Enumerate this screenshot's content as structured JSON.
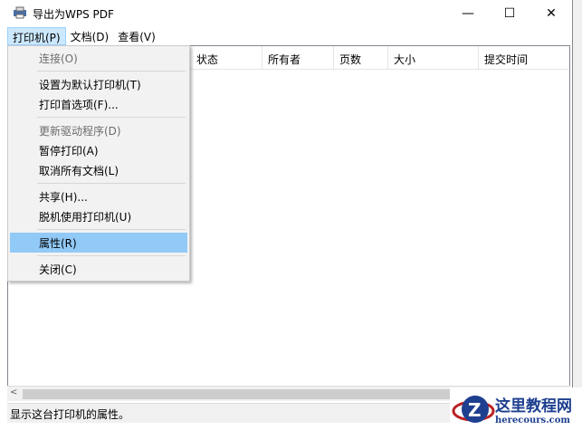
{
  "window": {
    "title": "导出为WPS PDF",
    "minimize": "—",
    "maximize": "☐",
    "close": "✕"
  },
  "menubar": [
    {
      "label": "打印机(P)"
    },
    {
      "label": "文档(D)"
    },
    {
      "label": "查看(V)"
    }
  ],
  "columns": [
    "状态",
    "所有者",
    "页数",
    "大小",
    "提交时间"
  ],
  "menu": {
    "items": [
      {
        "label": "连接(O)",
        "disabled": true
      },
      {
        "label": "设置为默认打印机(T)"
      },
      {
        "label": "打印首选项(F)..."
      },
      {
        "label": "更新驱动程序(D)",
        "disabled": true
      },
      {
        "label": "暂停打印(A)"
      },
      {
        "label": "取消所有文档(L)"
      },
      {
        "label": "共享(H)..."
      },
      {
        "label": "脱机使用打印机(U)"
      },
      {
        "label": "属性(R)",
        "highlighted": true
      },
      {
        "label": "关闭(C)"
      }
    ]
  },
  "status": "显示这台打印机的属性。",
  "watermark": {
    "name": "这里教程网",
    "url": "herecours.com"
  }
}
